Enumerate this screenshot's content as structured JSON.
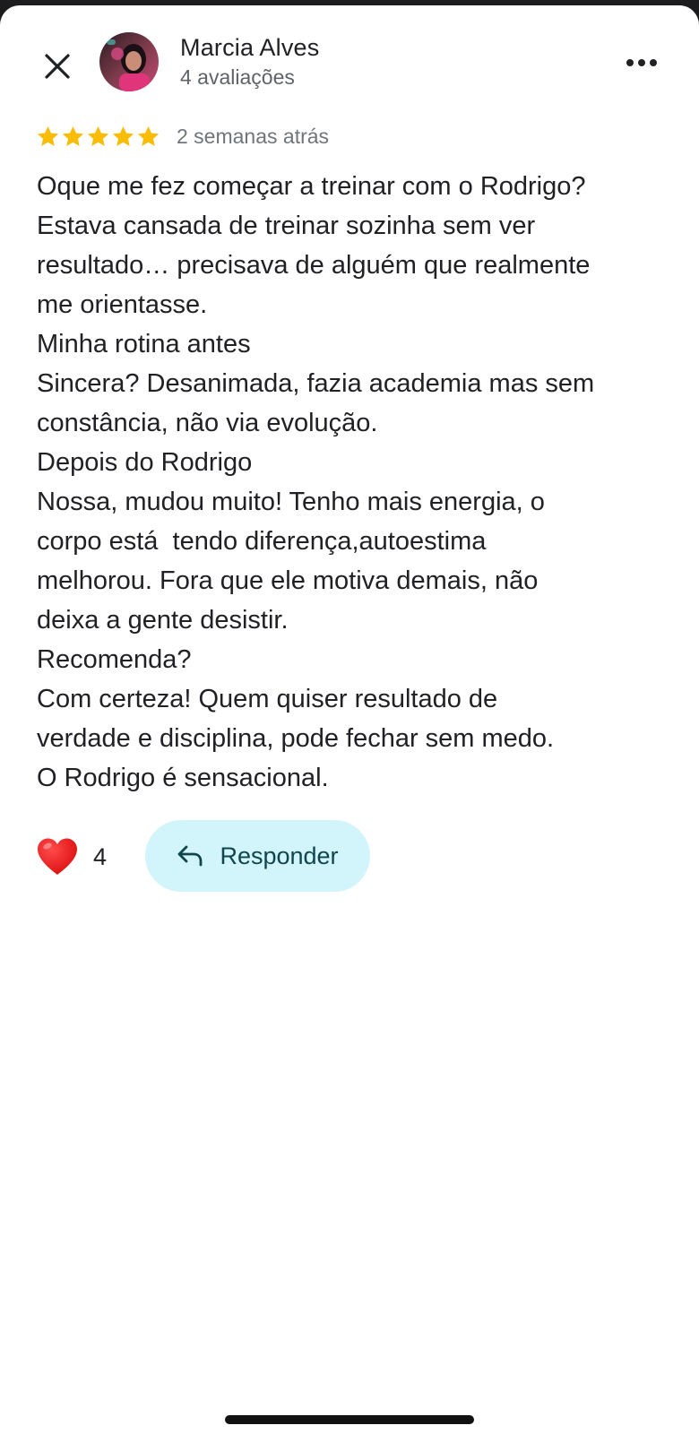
{
  "header": {
    "close_icon": "close-icon",
    "author_name": "Marcia Alves",
    "author_meta": "4 avaliações",
    "more_icon": "more-horizontal-icon"
  },
  "review": {
    "rating": 5,
    "rating_max": 5,
    "star_color": "#fbbc04",
    "date": "2 semanas atrás",
    "text": "Oque me fez começar a treinar com o Rodrigo?\nEstava cansada de treinar sozinha sem ver\nresultado… precisava de alguém que realmente\nme orientasse.\nMinha rotina antes\nSincera? Desanimada, fazia academia mas sem\nconstância, não via evolução.\nDepois do Rodrigo\nNossa, mudou muito! Tenho mais energia, o\ncorpo está  tendo diferença,autoestima\nmelhorou. Fora que ele motiva demais, não\ndeixa a gente desistir.\nRecomenda?\nCom certeza! Quem quiser resultado de\nverdade e disciplina, pode fechar sem medo.\nO Rodrigo é sensacional."
  },
  "actions": {
    "like_icon": "heart-icon",
    "like_count": "4",
    "reply_icon": "reply-icon",
    "reply_label": "Responder",
    "reply_bg_color": "#d2f4fb"
  }
}
